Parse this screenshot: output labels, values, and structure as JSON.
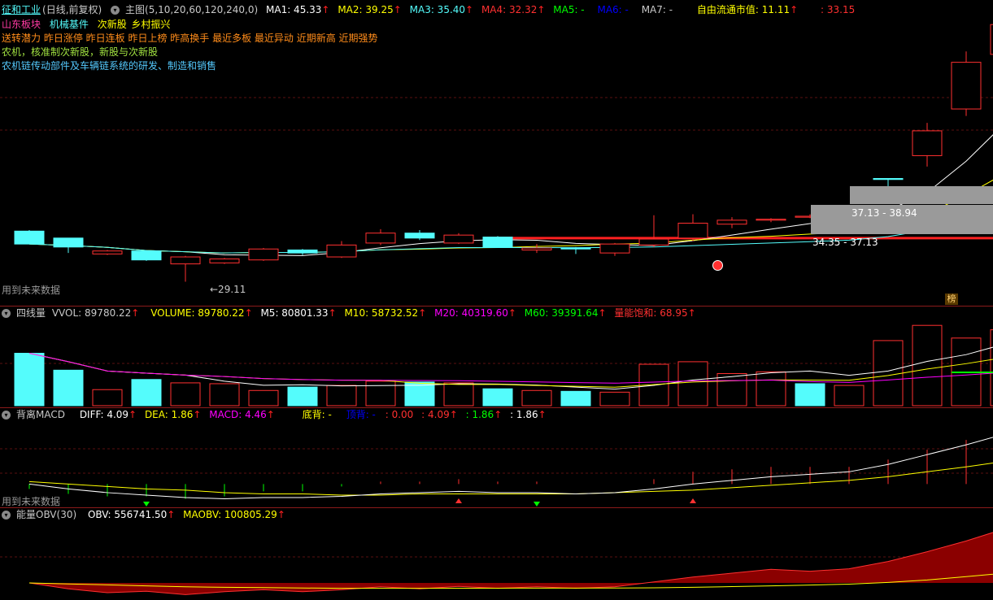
{
  "main_header": {
    "stock_name": "征和工业",
    "period": "(日线,前复权)",
    "indicator": "主图(5,10,20,60,120,240,0)",
    "ma1": "MA1: 45.33",
    "ma2": "MA2: 39.25",
    "ma3": "MA3: 35.40",
    "ma4": "MA4: 32.32",
    "ma5": "MA5: -",
    "ma6": "MA6: -",
    "ma7": "MA7: -",
    "float_cap": "自由流通市值: 11.11",
    "extra": ": 33.15",
    "up_arrow": "↑"
  },
  "tags_row1": [
    "山东板块",
    "机械基件",
    "次新股",
    "乡村振兴"
  ],
  "tags_row2": "送转潜力 昨日涨停 昨日连板 昨日上榜 昨高换手 最近多板 最近异动 近期新高 近期强势",
  "tags_row3": "农机，核准制次新股，新股与次新股",
  "tags_row4": "农机链传动部件及车辆链系统的研发、制造和销售",
  "main_labels": {
    "future_data": "用到未来数据",
    "low_price": "←29.11",
    "range1": "37.13 - 38.94",
    "range2": "34.35 - 37.13",
    "badge": "榜"
  },
  "vol_header": {
    "name": "四线量",
    "vvol": "VVOL: 89780.22",
    "volume": "VOLUME: 89780.22",
    "m5": "M5: 80801.33",
    "m10": "M10: 58732.52",
    "m20": "M20: 40319.60",
    "m60": "M60: 39391.64",
    "saturation": "量能饱和: 68.95"
  },
  "macd_header": {
    "name": "背离MACD",
    "diff": "DIFF: 4.09",
    "dea": "DEA: 1.86",
    "macd": "MACD: 4.46",
    "bottom": "底背: -",
    "top": "顶背: -",
    "v1": ": 0.00",
    "v2": ": 4.09",
    "v3": ": 1.86",
    "v4": ": 1.86",
    "future_data": "用到未来数据"
  },
  "obv_header": {
    "name": "能量OBV(30)",
    "obv": "OBV: 556741.50",
    "maobv": "MAOBV: 100805.29"
  },
  "colors": {
    "up": "#ff3030",
    "down": "#54fcfc",
    "yellow": "#ffff00",
    "magenta": "#ff00ff",
    "green": "#00ff00",
    "white": "#ffffff"
  },
  "chart_data": {
    "type": "candlestick",
    "categories": 26,
    "candles": [
      {
        "o": 34.2,
        "c": 32.9,
        "h": 34.3,
        "l": 32.9
      },
      {
        "o": 33.5,
        "c": 32.6,
        "h": 33.5,
        "l": 32.0
      },
      {
        "o": 31.9,
        "c": 32.2,
        "h": 32.3,
        "l": 31.8
      },
      {
        "o": 32.2,
        "c": 31.3,
        "h": 32.2,
        "l": 31.2
      },
      {
        "o": 30.9,
        "c": 31.6,
        "h": 31.7,
        "l": 29.11
      },
      {
        "o": 31.0,
        "c": 31.4,
        "h": 31.5,
        "l": 30.9
      },
      {
        "o": 31.3,
        "c": 32.4,
        "h": 32.5,
        "l": 31.2
      },
      {
        "o": 32.3,
        "c": 32.0,
        "h": 32.4,
        "l": 31.8
      },
      {
        "o": 31.6,
        "c": 32.8,
        "h": 33.2,
        "l": 31.5
      },
      {
        "o": 33.0,
        "c": 34.0,
        "h": 34.4,
        "l": 32.8
      },
      {
        "o": 34.0,
        "c": 33.5,
        "h": 34.3,
        "l": 33.3
      },
      {
        "o": 33.0,
        "c": 33.8,
        "h": 34.0,
        "l": 32.9
      },
      {
        "o": 33.6,
        "c": 32.6,
        "h": 33.7,
        "l": 32.5
      },
      {
        "o": 32.3,
        "c": 32.5,
        "h": 32.9,
        "l": 32.0
      },
      {
        "o": 32.5,
        "c": 32.4,
        "h": 32.6,
        "l": 31.9
      },
      {
        "o": 32.0,
        "c": 32.9,
        "h": 33.0,
        "l": 31.7
      },
      {
        "o": 32.8,
        "c": 33.4,
        "h": 35.8,
        "l": 32.6
      },
      {
        "o": 33.5,
        "c": 35.0,
        "h": 35.9,
        "l": 33.2
      },
      {
        "o": 34.9,
        "c": 35.3,
        "h": 35.6,
        "l": 34.5
      },
      {
        "o": 35.3,
        "c": 35.4,
        "h": 35.5,
        "l": 35.1
      },
      {
        "o": 35.6,
        "c": 35.7,
        "h": 35.9,
        "l": 35.5
      },
      {
        "o": 35.5,
        "c": 35.6,
        "h": 35.8,
        "l": 35.4
      },
      {
        "o": 39.5,
        "c": 39.4,
        "h": 39.5,
        "l": 37.4
      },
      {
        "o": 41.8,
        "c": 44.3,
        "h": 45.1,
        "l": 40.7
      },
      {
        "o": 46.5,
        "c": 51.2,
        "h": 52.3,
        "l": 45.8
      },
      {
        "o": 52.0,
        "c": 55.0,
        "h": 56.0,
        "l": 51.5
      }
    ],
    "volume": [
      62000,
      42000,
      19000,
      31000,
      27000,
      26000,
      18000,
      22000,
      24000,
      29000,
      28000,
      27000,
      20000,
      18000,
      17000,
      16000,
      49000,
      52000,
      38000,
      40000,
      26000,
      24000,
      77000,
      95000,
      80000,
      89780.22
    ],
    "volume_up": [
      false,
      false,
      true,
      false,
      true,
      true,
      true,
      false,
      true,
      true,
      false,
      true,
      false,
      true,
      false,
      true,
      true,
      true,
      true,
      true,
      false,
      true,
      true,
      true,
      true,
      true
    ],
    "macd_diff": [
      0.0,
      -0.4,
      -0.7,
      -0.9,
      -1.1,
      -1.2,
      -1.1,
      -1.1,
      -1.0,
      -0.8,
      -0.7,
      -0.6,
      -0.7,
      -0.7,
      -0.8,
      -0.7,
      -0.4,
      0.0,
      0.3,
      0.6,
      0.8,
      1.0,
      1.6,
      2.4,
      3.2,
      4.09
    ],
    "macd_dea": [
      0.2,
      0.0,
      -0.2,
      -0.4,
      -0.5,
      -0.7,
      -0.8,
      -0.8,
      -0.9,
      -0.9,
      -0.8,
      -0.8,
      -0.8,
      -0.8,
      -0.8,
      -0.7,
      -0.6,
      -0.5,
      -0.3,
      -0.1,
      0.1,
      0.3,
      0.6,
      1.0,
      1.4,
      1.86
    ],
    "obv": [
      0,
      -60,
      -100,
      -85,
      -120,
      -90,
      -70,
      -90,
      -70,
      -40,
      -60,
      -35,
      -55,
      -40,
      -55,
      -40,
      10,
      60,
      100,
      140,
      120,
      145,
      220,
      320,
      430,
      556.74
    ],
    "maobv": [
      0,
      -10,
      -20,
      -30,
      -40,
      -45,
      -48,
      -52,
      -55,
      -55,
      -55,
      -54,
      -54,
      -53,
      -53,
      -52,
      -50,
      -45,
      -38,
      -30,
      -22,
      -12,
      5,
      30,
      65,
      100.8
    ]
  }
}
